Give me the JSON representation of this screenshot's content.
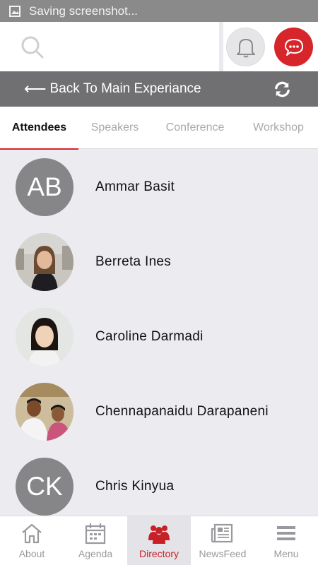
{
  "status_bar": {
    "text": "Saving screenshot..."
  },
  "search": {
    "placeholder": ""
  },
  "back_bar": {
    "arrow": "⟵",
    "label": "Back To Main Experiance"
  },
  "tabs": [
    {
      "label": "Attendees",
      "active": true
    },
    {
      "label": "Speakers",
      "active": false
    },
    {
      "label": "Conference",
      "active": false
    },
    {
      "label": "Workshop",
      "active": false
    }
  ],
  "attendees": [
    {
      "name": "Ammar Basit",
      "initials": "AB",
      "photo": false
    },
    {
      "name": "Berreta Ines",
      "initials": "",
      "photo": true
    },
    {
      "name": "Caroline Darmadi",
      "initials": "",
      "photo": true
    },
    {
      "name": "Chennapanaidu Darapaneni",
      "initials": "",
      "photo": true
    },
    {
      "name": "Chris Kinyua",
      "initials": "CK",
      "photo": false
    }
  ],
  "bottom_nav": [
    {
      "label": "About",
      "icon": "home-icon",
      "active": false
    },
    {
      "label": "Agenda",
      "icon": "calendar-icon",
      "active": false
    },
    {
      "label": "Directory",
      "icon": "people-icon",
      "active": true
    },
    {
      "label": "NewsFeed",
      "icon": "newspaper-icon",
      "active": false
    },
    {
      "label": "Menu",
      "icon": "hamburger-icon",
      "active": false
    }
  ],
  "colors": {
    "accent": "#d6252b",
    "bar": "#707073",
    "status": "#8a8a8a"
  }
}
